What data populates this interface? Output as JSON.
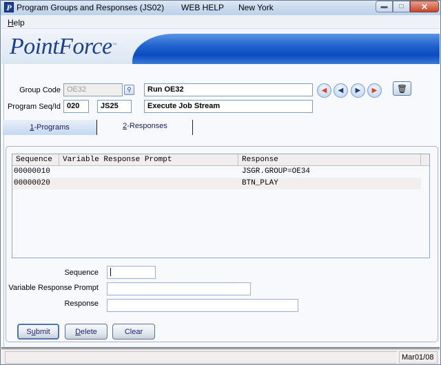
{
  "window": {
    "title": "Program Groups and Responses (JS02)",
    "help_label": "WEB HELP",
    "location": "New York",
    "controls": {
      "minimize": "minimize",
      "maximize": "maximize",
      "close": "close"
    }
  },
  "menu": {
    "items": [
      {
        "label": "Help",
        "mnemonic": "H"
      }
    ]
  },
  "banner": {
    "logo_text": "PointForce",
    "trademark": "™"
  },
  "header": {
    "group_code_label": "Group Code",
    "group_code_value": "OE32",
    "group_description": "Run OE32",
    "program_seq_label": "Program Seq/Id",
    "program_seq_value": "020",
    "program_id_value": "JS25",
    "program_description": "Execute Job Stream",
    "icons": {
      "lookup": "lookup-icon",
      "first": "first-record-icon",
      "previous": "previous-record-icon",
      "next": "next-record-icon",
      "last": "last-record-icon",
      "delete": "trash-icon"
    }
  },
  "tabs": [
    {
      "label": "Programs",
      "prefix": "1",
      "active": false
    },
    {
      "label": "Responses",
      "prefix": "2",
      "active": true
    }
  ],
  "grid": {
    "columns": [
      "Sequence",
      "Variable Response Prompt",
      "Response"
    ],
    "rows": [
      {
        "sequence": "00000010",
        "prompt": "",
        "response": "JSGR.GROUP=OE34"
      },
      {
        "sequence": "00000020",
        "prompt": "",
        "response": "BTN_PLAY"
      }
    ]
  },
  "form": {
    "sequence_label": "Sequence",
    "sequence_value": "",
    "prompt_label": "Variable Response Prompt",
    "prompt_value": "",
    "response_label": "Response",
    "response_value": ""
  },
  "buttons": {
    "submit": {
      "pre": "S",
      "u": "u",
      "post": "bmit"
    },
    "delete": {
      "pre": "",
      "u": "D",
      "post": "elete"
    },
    "clear": {
      "pre": "Clear",
      "u": "",
      "post": ""
    }
  },
  "status": {
    "message": "",
    "date": "Mar01/08"
  },
  "colors": {
    "accent": "#1d3f8d",
    "banner_blue": "#0b4cc0",
    "nav_red": "#e2401c",
    "nav_blue": "#173f83"
  }
}
